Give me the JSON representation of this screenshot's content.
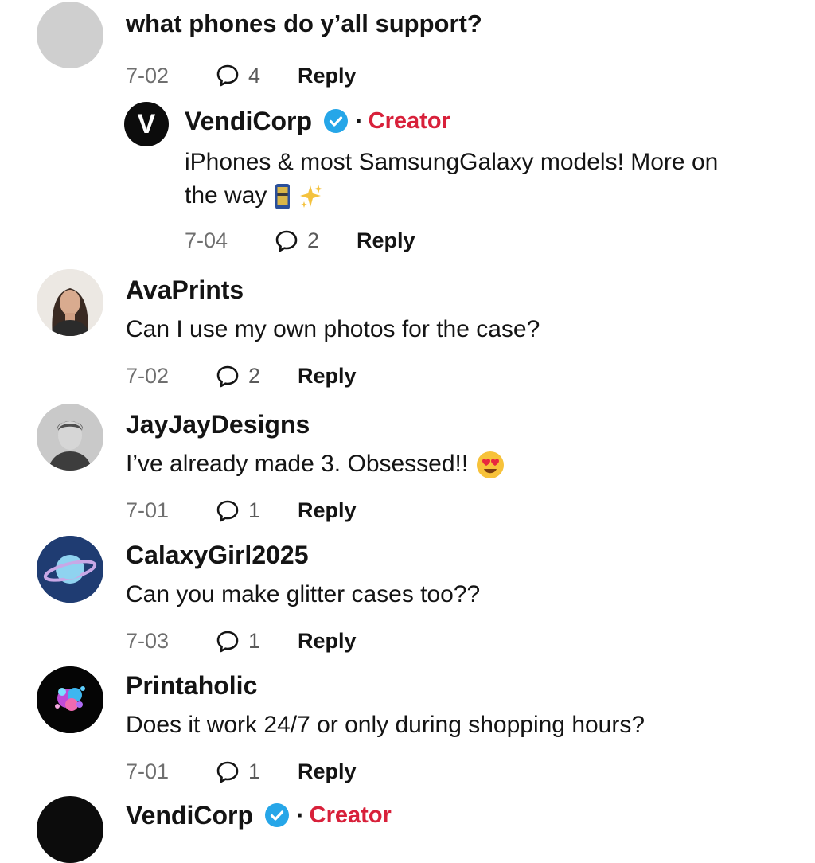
{
  "comments": [
    {
      "id": "c1",
      "text": "what phones do y’all support?",
      "date": "7-02",
      "replies": "4",
      "reply_label": "Reply"
    },
    {
      "id": "c2",
      "username": "VendiCorp",
      "creator_label": "Creator",
      "avatar_letter": "V",
      "text": "iPhones & most SamsungGalaxy models! More on the way",
      "date": "7-04",
      "replies": "2",
      "reply_label": "Reply"
    },
    {
      "id": "c3",
      "username": "AvaPrints",
      "text": "Can I use my own photos for the case?",
      "date": "7-02",
      "replies": "2",
      "reply_label": "Reply"
    },
    {
      "id": "c4",
      "username": "JayJayDesigns",
      "text": "I’ve already made 3. Obsessed!!",
      "date": "7-01",
      "replies": "1",
      "reply_label": "Reply"
    },
    {
      "id": "c5",
      "username": "CalaxyGirl2025",
      "text": "Can you make glitter cases too??",
      "date": "7-03",
      "replies": "1",
      "reply_label": "Reply"
    },
    {
      "id": "c6",
      "username": "Printaholic",
      "text": "Does it work 24/7 or only during shopping hours?",
      "date": "7-01",
      "replies": "1",
      "reply_label": "Reply"
    },
    {
      "id": "c7",
      "username": "VendiCorp",
      "creator_label": "Creator"
    }
  ]
}
